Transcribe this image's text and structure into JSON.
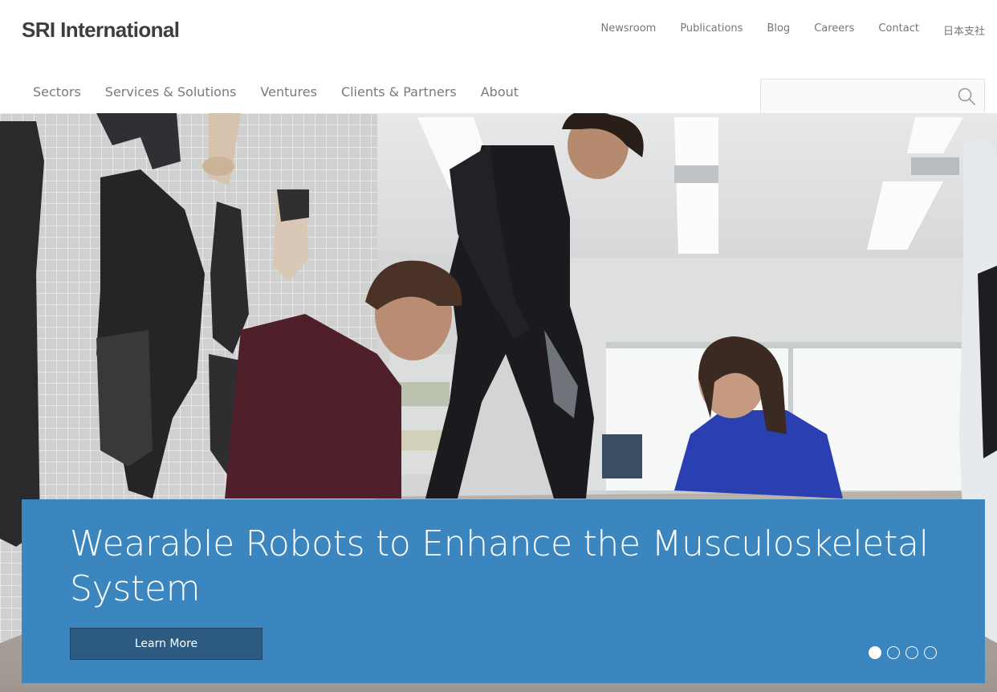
{
  "brand": {
    "logo_text": "SRI International"
  },
  "utility_nav": [
    {
      "label": "Newsroom"
    },
    {
      "label": "Publications"
    },
    {
      "label": "Blog"
    },
    {
      "label": "Careers"
    },
    {
      "label": "Contact"
    },
    {
      "label": "日本支社"
    }
  ],
  "main_nav": [
    {
      "label": "Sectors"
    },
    {
      "label": "Services & Solutions"
    },
    {
      "label": "Ventures"
    },
    {
      "label": "Clients & Partners"
    },
    {
      "label": "About"
    }
  ],
  "search": {
    "placeholder": "",
    "icon": "search-icon"
  },
  "hero": {
    "title": "Wearable Robots to Enhance the Musculoskeletal System",
    "button_label": "Learn More",
    "slides_total": 4,
    "active_slide": 1,
    "panel_color": "#3b86bf",
    "button_color": "#2c5a80"
  }
}
